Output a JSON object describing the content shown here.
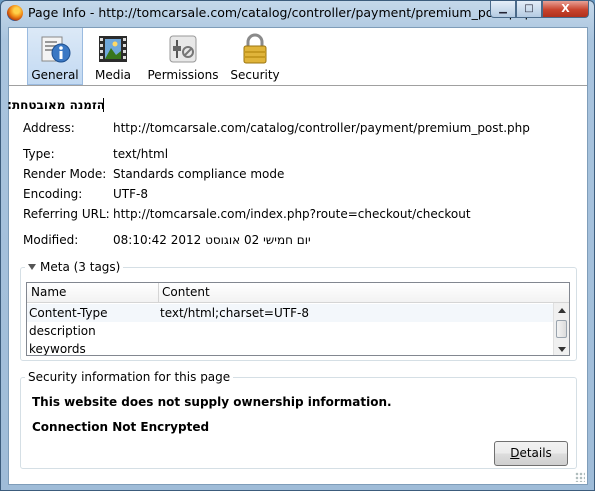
{
  "window": {
    "title": "Page Info - http://tomcarsale.com/catalog/controller/payment/premium_post.php",
    "minimize_glyph": "▁",
    "maximize_glyph": "□",
    "close_glyph": "X"
  },
  "tabs": [
    {
      "label": "General",
      "icon": "general-info-icon",
      "selected": true
    },
    {
      "label": "Media",
      "icon": "media-icon",
      "selected": false
    },
    {
      "label": "Permissions",
      "icon": "permissions-icon",
      "selected": false
    },
    {
      "label": "Security",
      "icon": "lock-icon",
      "selected": false
    }
  ],
  "general": {
    "site_title": "הזמנה מאובטחת:",
    "fields": [
      {
        "label": "Address:",
        "value": "http://tomcarsale.com/catalog/controller/payment/premium_post.php"
      },
      {
        "label": "Type:",
        "value": "text/html"
      },
      {
        "label": "Render Mode:",
        "value": "Standards compliance mode"
      },
      {
        "label": "Encoding:",
        "value": "UTF-8"
      },
      {
        "label": "Referring URL:",
        "value": "http://tomcarsale.com/index.php?route=checkout/checkout"
      },
      {
        "label": "Modified:",
        "value": "יום חמישי 02 אוגוסט 2012 08:10:42"
      }
    ]
  },
  "meta": {
    "legend": "Meta (3 tags)",
    "columns": [
      "Name",
      "Content"
    ],
    "rows": [
      {
        "name": "Content-Type",
        "content": "text/html;charset=UTF-8"
      },
      {
        "name": "description",
        "content": ""
      },
      {
        "name": "keywords",
        "content": ""
      }
    ]
  },
  "security": {
    "legend": "Security information for this page",
    "ownership": "This website does not supply ownership information.",
    "connection": "Connection Not Encrypted",
    "details_prefix": "D",
    "details_rest": "etails"
  }
}
